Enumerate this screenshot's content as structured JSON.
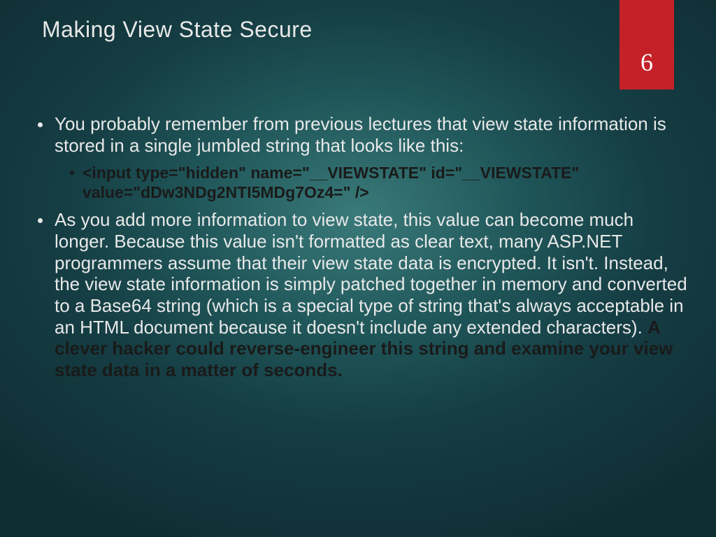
{
  "slide": {
    "title": "Making View State Secure",
    "pageNumber": "6",
    "bullet1": "You probably remember from previous lectures that view state information is stored in a single jumbled string that looks like this:",
    "code": "<input type=\"hidden\" name=\"__VIEWSTATE\" id=\"__VIEWSTATE\" value=\"dDw3NDg2NTI5MDg7Oz4=\" />",
    "bullet2_light": "As you add more information to view state, this value can become much longer. Because this value isn't formatted as clear text, many ASP.NET programmers assume that their view state data is encrypted. It isn't. Instead, the view state information is simply patched together in memory and converted to a Base64 string (which is a special type of string that's always acceptable in an HTML document because it doesn't include any extended characters). ",
    "bullet2_bold": "A clever hacker could reverse-engineer this string and examine your view state data in a matter of seconds."
  }
}
